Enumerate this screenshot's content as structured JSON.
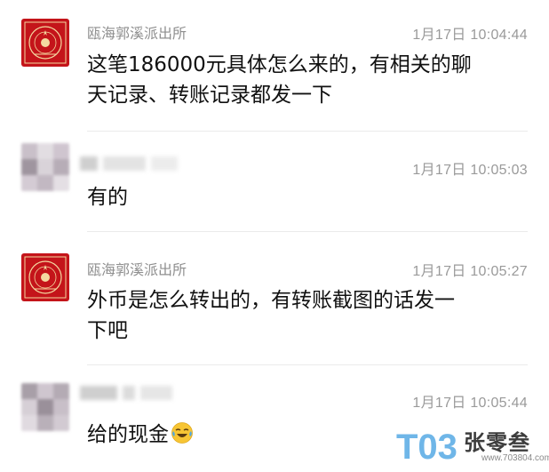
{
  "messages": [
    {
      "sender": "瓯海郭溪派出所",
      "time": "1月17日 10:04:44",
      "text_line1": "这笔186000元具体怎么来的，有相关的聊",
      "text_line2": "天记录、转账记录都发一下",
      "avatar": "police-seal-icon"
    },
    {
      "sender": "",
      "time": "1月17日 10:05:03",
      "text_line1": "有的",
      "avatar": "blurred-avatar"
    },
    {
      "sender": "瓯海郭溪派出所",
      "time": "1月17日 10:05:27",
      "text_line1": "外币是怎么转出的，有转账截图的话发一",
      "text_line2": "下吧",
      "avatar": "police-seal-icon"
    },
    {
      "sender": "",
      "time": "1月17日 10:05:44",
      "text_line1": "给的现金",
      "emoji": "laughing-tears-emoji",
      "avatar": "blurred-avatar"
    }
  ],
  "watermark": {
    "logo": "T03",
    "name": "张零叁",
    "site": "www.703804.com"
  },
  "colors": {
    "seal_red": "#c4141a",
    "text": "#111111",
    "meta": "#9a9a9a"
  }
}
